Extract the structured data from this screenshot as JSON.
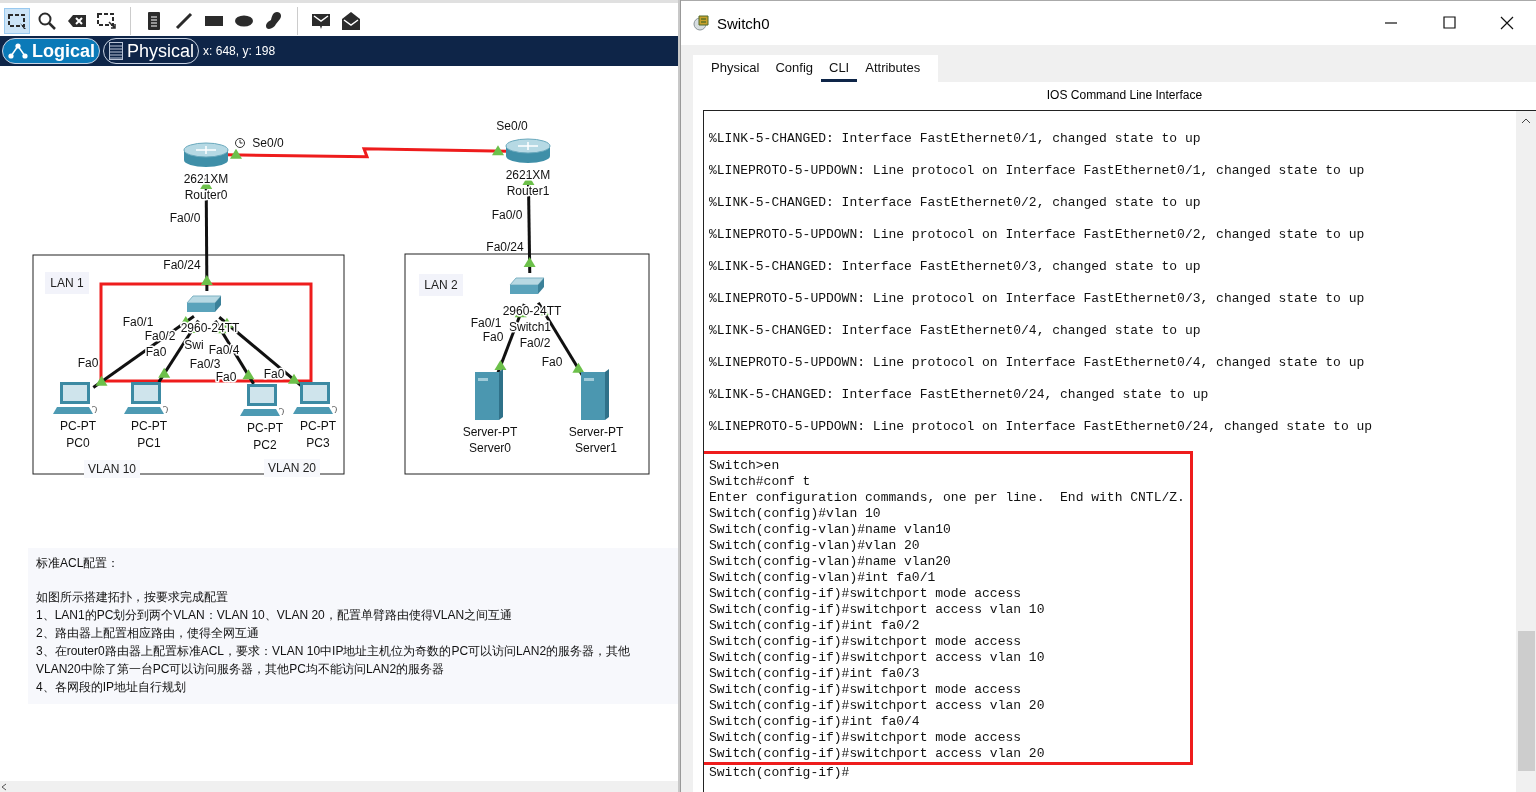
{
  "toolbar": {
    "tools": [
      {
        "kind": "select",
        "selected": true
      },
      {
        "kind": "zoom",
        "selected": false
      },
      {
        "kind": "delete",
        "selected": false
      },
      {
        "kind": "resize",
        "selected": false
      },
      {
        "kind": "note",
        "selected": false
      },
      {
        "kind": "line",
        "selected": false
      },
      {
        "kind": "rectangle",
        "selected": false
      },
      {
        "kind": "ellipse",
        "selected": false
      },
      {
        "kind": "freeform",
        "selected": false
      },
      {
        "kind": "simple-pdu",
        "selected": false
      },
      {
        "kind": "complex-pdu",
        "selected": false
      }
    ]
  },
  "view_tabs": [
    {
      "label": "Logical",
      "selected": true
    },
    {
      "label": "Physical",
      "selected": false
    }
  ],
  "coordinates": "x: 648, y: 198",
  "topology": {
    "areas": [
      {
        "label": "LAN 1",
        "vlan_labels": [
          "VLAN 10",
          "VLAN 20"
        ]
      },
      {
        "label": "LAN 2"
      }
    ],
    "devices": [
      {
        "kind": "router",
        "model": "2621XM",
        "name": "Router0"
      },
      {
        "kind": "router",
        "model": "2621XM",
        "name": "Router1"
      },
      {
        "kind": "switch",
        "model": "2960-24TT",
        "name": "Swi"
      },
      {
        "kind": "switch",
        "model": "2960-24TT",
        "name": "Switch1"
      },
      {
        "kind": "pc",
        "model": "PC-PT",
        "name": "PC0"
      },
      {
        "kind": "pc",
        "model": "PC-PT",
        "name": "PC1"
      },
      {
        "kind": "pc",
        "model": "PC-PT",
        "name": "PC2"
      },
      {
        "kind": "pc",
        "model": "PC-PT",
        "name": "PC3"
      },
      {
        "kind": "server",
        "model": "Server-PT",
        "name": "Server0"
      },
      {
        "kind": "server",
        "model": "Server-PT",
        "name": "Server1"
      }
    ],
    "links": [
      {
        "kind": "serial",
        "from_port": "Se0/0",
        "to_port": "Se0/0",
        "up": true
      },
      {
        "kind": "ethernet",
        "from_port": "Fa0/0",
        "to_port": "Fa0/24",
        "up": true
      },
      {
        "kind": "ethernet",
        "from_port": "Fa0/1",
        "to_port": "Fa0",
        "up": true
      },
      {
        "kind": "ethernet",
        "from_port": "Fa0/2",
        "to_port": "Fa0",
        "up": true
      },
      {
        "kind": "ethernet",
        "from_port": "Fa0/3",
        "to_port": "Fa0",
        "up": true
      },
      {
        "kind": "ethernet",
        "from_port": "Fa0/4",
        "to_port": "Fa0",
        "up": true
      },
      {
        "kind": "ethernet",
        "from_port": "Fa0/0",
        "to_port": "Fa0/24",
        "up": true
      },
      {
        "kind": "ethernet",
        "from_port": "Fa0/1",
        "to_port": "Fa0",
        "up": true
      },
      {
        "kind": "ethernet",
        "from_port": "Fa0/2",
        "to_port": "Fa0",
        "up": true
      }
    ]
  },
  "notes": {
    "title": "标准ACL配置：",
    "lines": [
      "如图所示搭建拓扑，按要求完成配置",
      "1、LAN1的PC划分到两个VLAN：VLAN 10、VLAN 20，配置单臂路由使得VLAN之间互通",
      "2、路由器上配置相应路由，使得全网互通",
      "3、在router0路由器上配置标准ACL，要求：VLAN 10中IP地址主机位为奇数的PC可以访问LAN2的服务器，其他",
      "VLAN20中除了第一台PC可以访问服务器，其他PC均不能访问LAN2的服务器",
      "4、各网段的IP地址自行规划"
    ]
  },
  "device_window": {
    "title": "Switch0",
    "tabs": [
      {
        "label": "Physical",
        "selected": false
      },
      {
        "label": "Config",
        "selected": false
      },
      {
        "label": "CLI",
        "selected": true
      },
      {
        "label": "Attributes",
        "selected": false
      }
    ],
    "panel_title": "IOS Command Line Interface",
    "cli": {
      "log": [
        "%LINK-5-CHANGED: Interface FastEthernet0/1, changed state to up",
        "%LINEPROTO-5-UPDOWN: Line protocol on Interface FastEthernet0/1, changed state to up",
        "%LINK-5-CHANGED: Interface FastEthernet0/2, changed state to up",
        "%LINEPROTO-5-UPDOWN: Line protocol on Interface FastEthernet0/2, changed state to up",
        "%LINK-5-CHANGED: Interface FastEthernet0/3, changed state to up",
        "%LINEPROTO-5-UPDOWN: Line protocol on Interface FastEthernet0/3, changed state to up",
        "%LINK-5-CHANGED: Interface FastEthernet0/4, changed state to up",
        "%LINEPROTO-5-UPDOWN: Line protocol on Interface FastEthernet0/4, changed state to up",
        "%LINK-5-CHANGED: Interface FastEthernet0/24, changed state to up",
        "%LINEPROTO-5-UPDOWN: Line protocol on Interface FastEthernet0/24, changed state to up"
      ],
      "highlighted_commands": [
        "Switch>en",
        "Switch#conf t",
        "Enter configuration commands, one per line.  End with CNTL/Z.",
        "Switch(config)#vlan 10",
        "Switch(config-vlan)#name vlan10",
        "Switch(config-vlan)#vlan 20",
        "Switch(config-vlan)#name vlan20",
        "Switch(config-vlan)#int fa0/1",
        "Switch(config-if)#switchport mode access",
        "Switch(config-if)#switchport access vlan 10",
        "Switch(config-if)#int fa0/2",
        "Switch(config-if)#switchport mode access",
        "Switch(config-if)#switchport access vlan 10",
        "Switch(config-if)#int fa0/3",
        "Switch(config-if)#switchport mode access",
        "Switch(config-if)#switchport access vlan 20",
        "Switch(config-if)#int fa0/4",
        "Switch(config-if)#switchport mode access",
        "Switch(config-if)#switchport access vlan 20"
      ],
      "commands": [
        "Switch(config-if)#"
      ]
    }
  }
}
